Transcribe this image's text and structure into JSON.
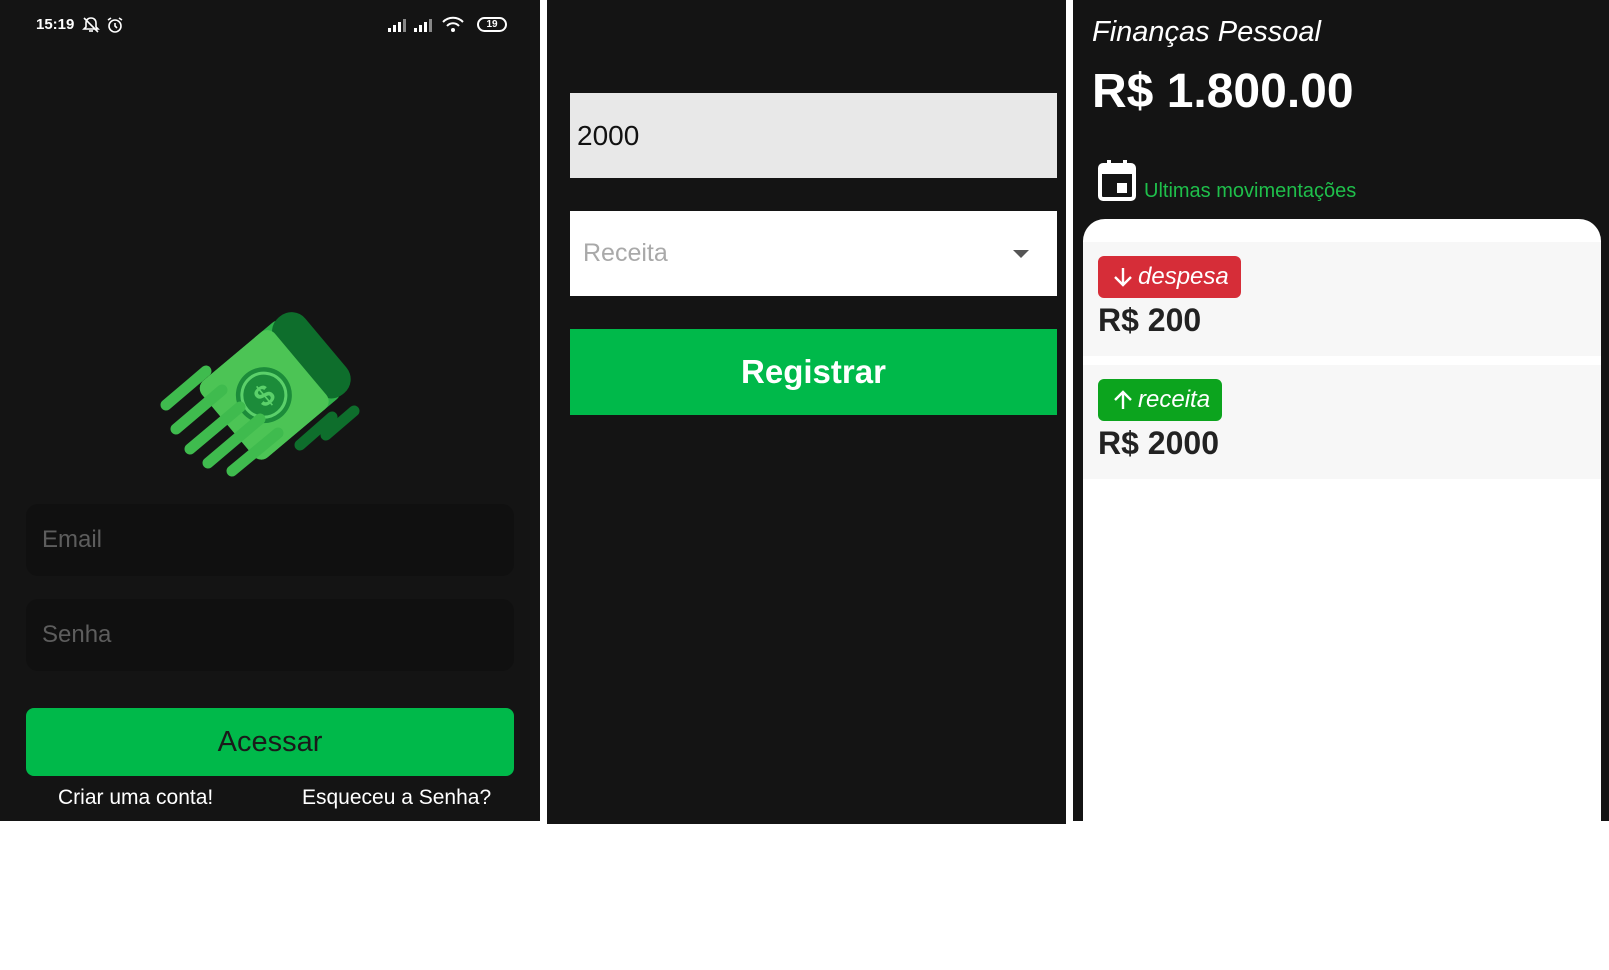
{
  "login": {
    "status_time": "15:19",
    "battery": "19",
    "email_placeholder": "Email",
    "senha_placeholder": "Senha",
    "acessar_label": "Acessar",
    "criar_label": "Criar uma conta!",
    "esqueceu_label": "Esqueceu a Senha?"
  },
  "register": {
    "valor_value": "2000",
    "tipo_selected": "Receita",
    "registrar_label": "Registrar"
  },
  "dashboard": {
    "app_title": "Finanças Pessoal",
    "balance": "R$ 1.800.00",
    "movements_label": "Ultimas movimentações",
    "movements": [
      {
        "type": "despesa",
        "amount": "R$ 200",
        "color": "#d62d38"
      },
      {
        "type": "receita",
        "amount": "R$ 2000",
        "color": "#0ca41e"
      }
    ]
  },
  "colors": {
    "green": "#00b94a",
    "background": "#141414",
    "accent_text": "#1fbf4b"
  }
}
